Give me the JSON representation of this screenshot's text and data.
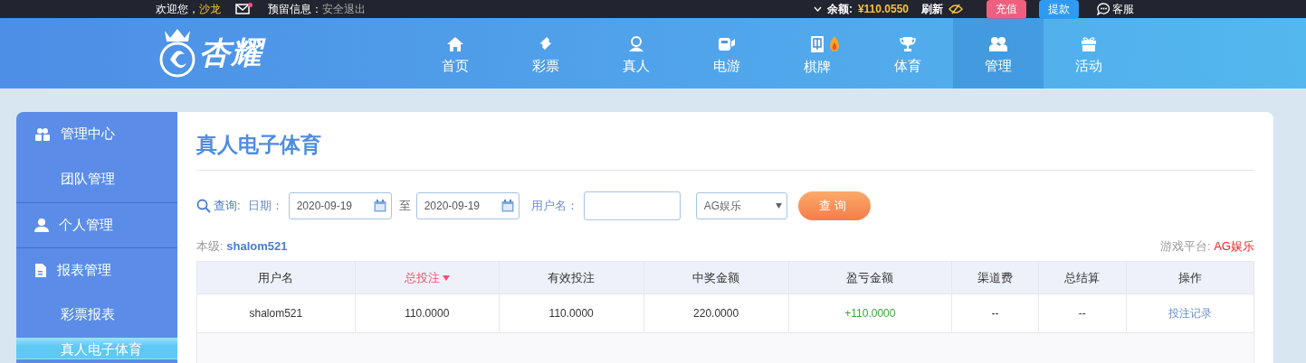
{
  "top_bar": {
    "welcome": "欢迎您，",
    "username": "沙龙",
    "mail_unread": true,
    "reserved_label": "预留信息：",
    "logout": "安全退出",
    "balance_label": "余额:",
    "balance": "¥110.0550",
    "refresh": "刷新",
    "deposit": "充值",
    "withdraw": "提款",
    "service": "客服"
  },
  "logo": {
    "text": "杏耀"
  },
  "nav": [
    {
      "label": "首页",
      "selected": false,
      "hot": false
    },
    {
      "label": "彩票",
      "selected": false,
      "hot": false
    },
    {
      "label": "真人",
      "selected": false,
      "hot": false
    },
    {
      "label": "电游",
      "selected": false,
      "hot": false
    },
    {
      "label": "棋牌",
      "selected": false,
      "hot": true
    },
    {
      "label": "体育",
      "selected": false,
      "hot": false
    },
    {
      "label": "管理",
      "selected": true,
      "hot": false
    },
    {
      "label": "活动",
      "selected": false,
      "hot": false
    }
  ],
  "sidebar": {
    "items": [
      {
        "kind": "group",
        "label": "管理中心",
        "selected": false
      },
      {
        "kind": "sub",
        "label": "团队管理",
        "selected": false
      },
      {
        "kind": "group",
        "label": "个人管理",
        "selected": false
      },
      {
        "kind": "group",
        "label": "报表管理",
        "selected": false
      },
      {
        "kind": "sub",
        "label": "彩票报表",
        "selected": false
      },
      {
        "kind": "sub",
        "label": "真人电子体育",
        "selected": true
      }
    ]
  },
  "page_title": "真人电子体育",
  "filters": {
    "query_label": "查询:",
    "date_label": "日期：",
    "date_from": "2020-09-19",
    "to_label": "至",
    "date_to": "2020-09-19",
    "username_label": "用户名：",
    "platform": "AG娱乐",
    "search_button": "查询"
  },
  "level": {
    "label": "本级:",
    "value": "shalom521"
  },
  "platform_info": {
    "label": "游戏平台:",
    "value": "AG娱乐"
  },
  "table": {
    "columns": [
      {
        "label": "用户名",
        "kind": "text",
        "sorted": false
      },
      {
        "label": "总投注",
        "kind": "text",
        "sorted": true
      },
      {
        "label": "有效投注",
        "kind": "text",
        "sorted": false
      },
      {
        "label": "中奖金额",
        "kind": "text",
        "sorted": false
      },
      {
        "label": "盈亏金额",
        "kind": "profit",
        "sorted": false
      },
      {
        "label": "渠道费",
        "kind": "text",
        "sorted": false
      },
      {
        "label": "总结算",
        "kind": "text",
        "sorted": false
      },
      {
        "label": "操作",
        "kind": "link",
        "sorted": false
      }
    ],
    "rows": [
      [
        "shalom521",
        "110.0000",
        "110.0000",
        "220.0000",
        "+110.0000",
        "--",
        "--",
        "投注记录"
      ]
    ]
  }
}
